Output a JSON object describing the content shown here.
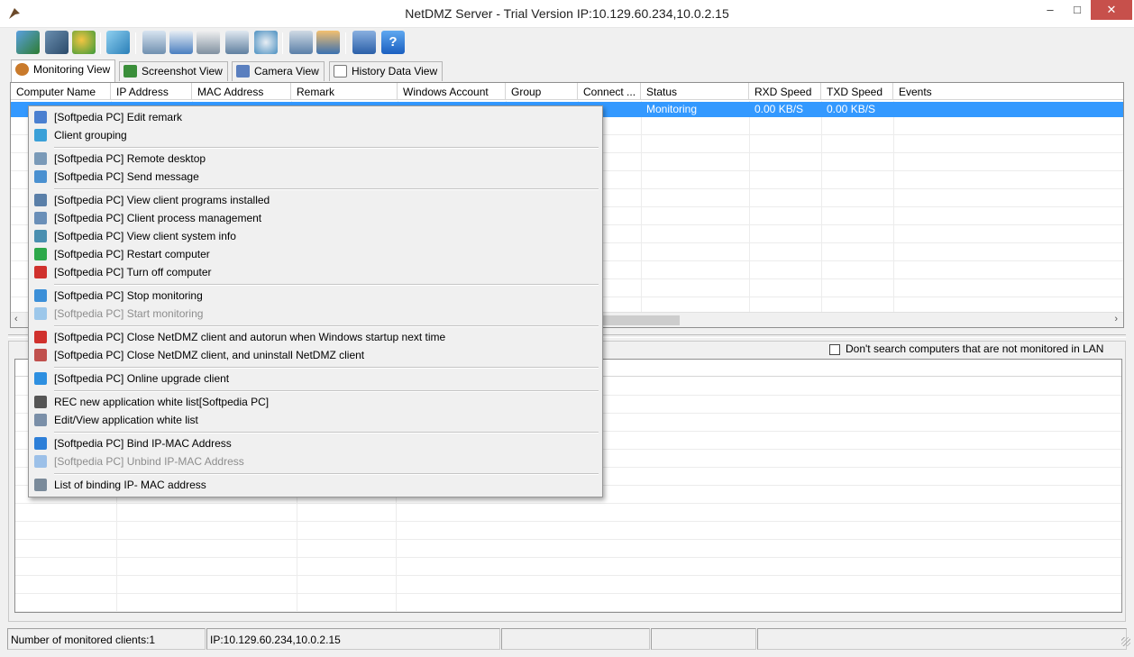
{
  "window": {
    "title": "NetDMZ Server - Trial Version IP:10.129.60.234,10.0.2.15",
    "minimize": "‒",
    "maximize": "□",
    "close": "✕"
  },
  "toolbar": {
    "icons": [
      "clients-icon",
      "settings-icon",
      "users-icon",
      "key-icon",
      "remote-desktop-icon",
      "message-icon",
      "search-icon",
      "windows-icon",
      "disk-icon",
      "screen-icon",
      "user-card-icon",
      "cart-icon",
      "help-icon"
    ]
  },
  "tabs": [
    {
      "label": "Monitoring View",
      "icon": "monitoring-icon",
      "color": "#c97a2b"
    },
    {
      "label": "Screenshot View",
      "icon": "screenshot-icon",
      "color": "#3a8e3a"
    },
    {
      "label": "Camera View",
      "icon": "camera-icon",
      "color": "#5a7fbf"
    },
    {
      "label": "History Data View",
      "icon": "history-icon",
      "color": "#777777"
    }
  ],
  "table": {
    "columns": [
      "Computer Name",
      "IP Address",
      "MAC Address",
      "Remark",
      "Windows Account",
      "Group",
      "Connect ...",
      "Status",
      "RXD Speed",
      "TXD Speed",
      "Events"
    ],
    "selected_row": {
      "status": "Monitoring",
      "rxd": "0.00 KB/S",
      "txd": "0.00 KB/S"
    },
    "selection_color": "#3399ff"
  },
  "lower": {
    "checkbox_label": "Don't search computers that are not monitored in LAN",
    "checkbox_checked": false
  },
  "statusbar": {
    "clients": "Number of monitored clients:1",
    "ip": "IP:10.129.60.234,10.0.2.15"
  },
  "context_menu": {
    "items": [
      {
        "label": "[Softpedia PC] Edit remark",
        "icon": "edit-icon",
        "color": "#4a7fd0",
        "enabled": true
      },
      {
        "label": "Client grouping",
        "icon": "group-icon",
        "color": "#3aa0d8",
        "enabled": true
      },
      {
        "label": "[Softpedia PC] Remote desktop",
        "icon": "remote-desktop-icon",
        "color": "#7a9ab8",
        "enabled": true
      },
      {
        "label": "[Softpedia PC] Send message",
        "icon": "send-message-icon",
        "color": "#4a90d0",
        "enabled": true
      },
      {
        "label": "[Softpedia PC] View client programs installed",
        "icon": "programs-icon",
        "color": "#5a7fa8",
        "enabled": true
      },
      {
        "label": "[Softpedia PC] Client process management",
        "icon": "process-icon",
        "color": "#6a8fb8",
        "enabled": true
      },
      {
        "label": "[Softpedia PC] View client system info",
        "icon": "system-info-icon",
        "color": "#4a8fb0",
        "enabled": true
      },
      {
        "label": "[Softpedia PC] Restart computer",
        "icon": "restart-icon",
        "color": "#2da84a",
        "enabled": true
      },
      {
        "label": "[Softpedia PC] Turn off computer",
        "icon": "power-icon",
        "color": "#d0312d",
        "enabled": true
      },
      {
        "label": "[Softpedia PC] Stop monitoring",
        "icon": "pause-icon",
        "color": "#3b8fd8",
        "enabled": true
      },
      {
        "label": "[Softpedia PC] Start monitoring",
        "icon": "play-icon",
        "color": "#9cc7ea",
        "enabled": false
      },
      {
        "label": "[Softpedia PC] Close NetDMZ client and autorun when Windows startup next time",
        "icon": "close-x-icon",
        "color": "#d0312d",
        "enabled": true
      },
      {
        "label": "[Softpedia PC] Close NetDMZ client, and uninstall NetDMZ client",
        "icon": "uninstall-icon",
        "color": "#c0504d",
        "enabled": true
      },
      {
        "label": "[Softpedia PC] Online upgrade client",
        "icon": "upgrade-arrow-icon",
        "color": "#2d8fe0",
        "enabled": true
      },
      {
        "label": "REC new application white list[Softpedia PC]",
        "icon": "film-icon",
        "color": "#555555",
        "enabled": true
      },
      {
        "label": "Edit/View application white list",
        "icon": "list-edit-icon",
        "color": "#7a8fa8",
        "enabled": true
      },
      {
        "label": "[Softpedia PC] Bind IP-MAC Address",
        "icon": "lock-icon",
        "color": "#2d7fd8",
        "enabled": true
      },
      {
        "label": "[Softpedia PC] Unbind IP-MAC Address",
        "icon": "unlock-icon",
        "color": "#9cc0e8",
        "enabled": false
      },
      {
        "label": "List of binding IP- MAC address",
        "icon": "binding-list-icon",
        "color": "#7a8a9a",
        "enabled": true
      }
    ]
  }
}
